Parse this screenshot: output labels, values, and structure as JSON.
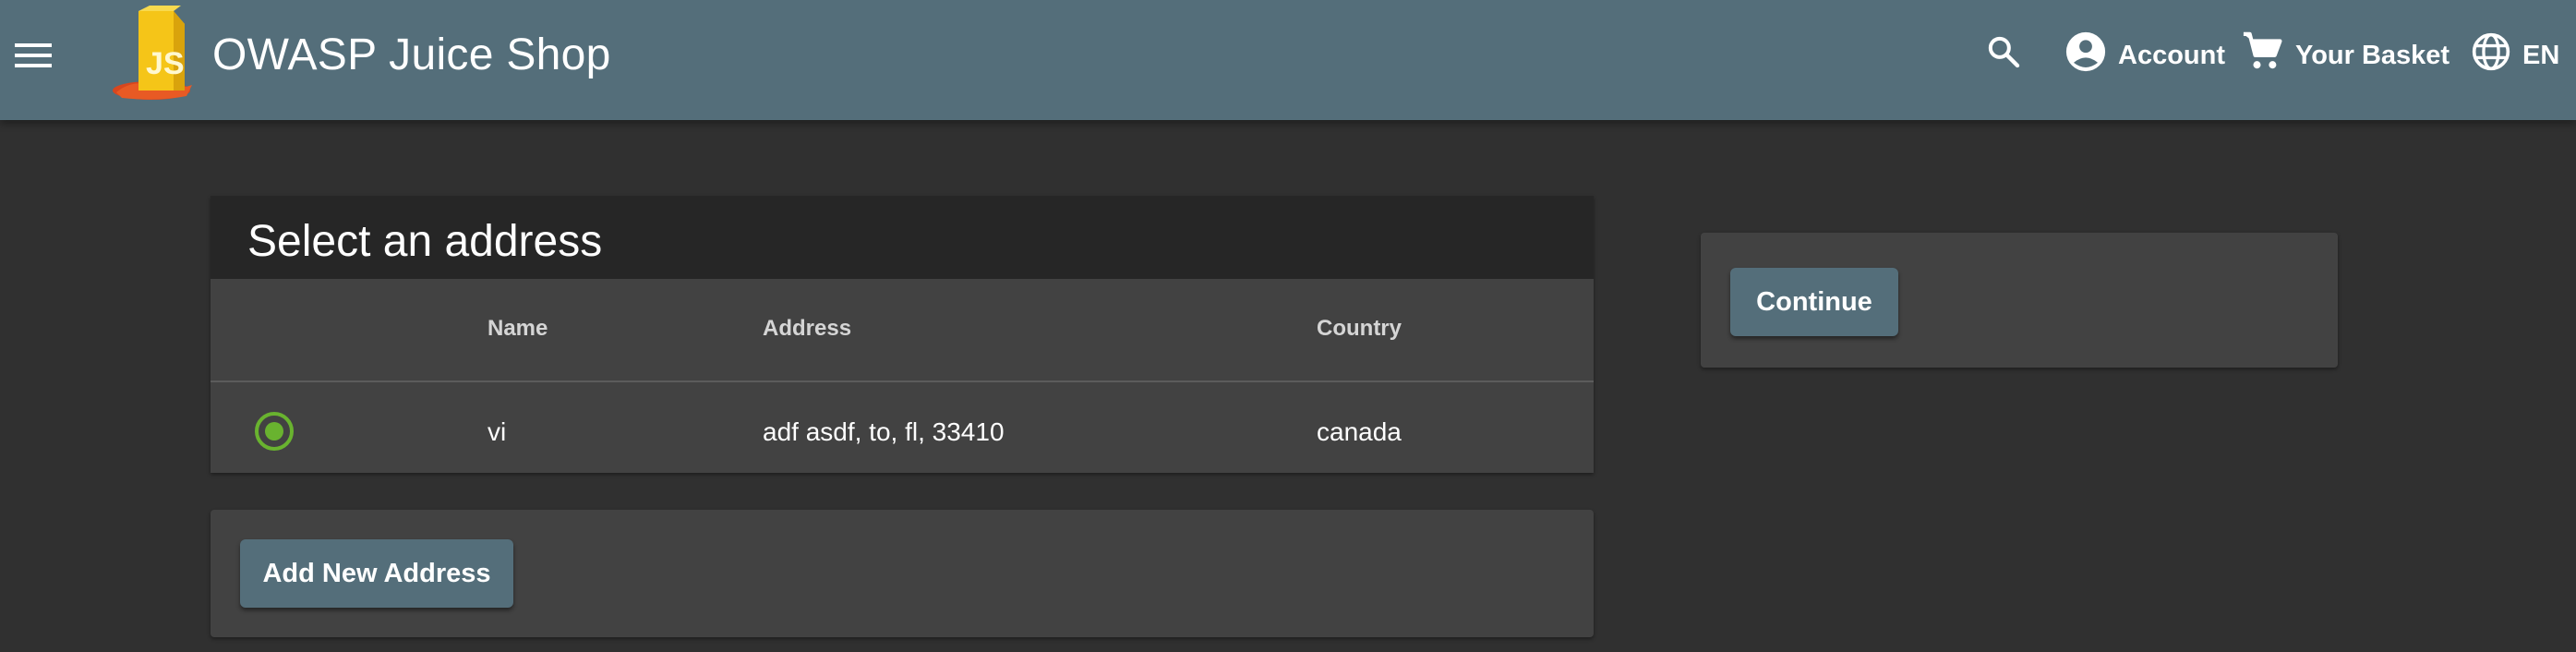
{
  "header": {
    "title": "OWASP Juice Shop",
    "account_label": "Account",
    "basket_label": "Your Basket",
    "language_label": "EN",
    "color": "#546e7a"
  },
  "address_selection": {
    "title": "Select an address",
    "columns": [
      "Name",
      "Address",
      "Country"
    ],
    "rows": [
      {
        "selected": true,
        "name": "vi",
        "address": "adf asdf, to, fl, 33410",
        "country": "canada"
      }
    ],
    "add_button_label": "Add New Address"
  },
  "checkout": {
    "continue_label": "Continue"
  },
  "colors": {
    "background": "#303030",
    "card": "#424242",
    "accent_green": "#69b32f"
  }
}
